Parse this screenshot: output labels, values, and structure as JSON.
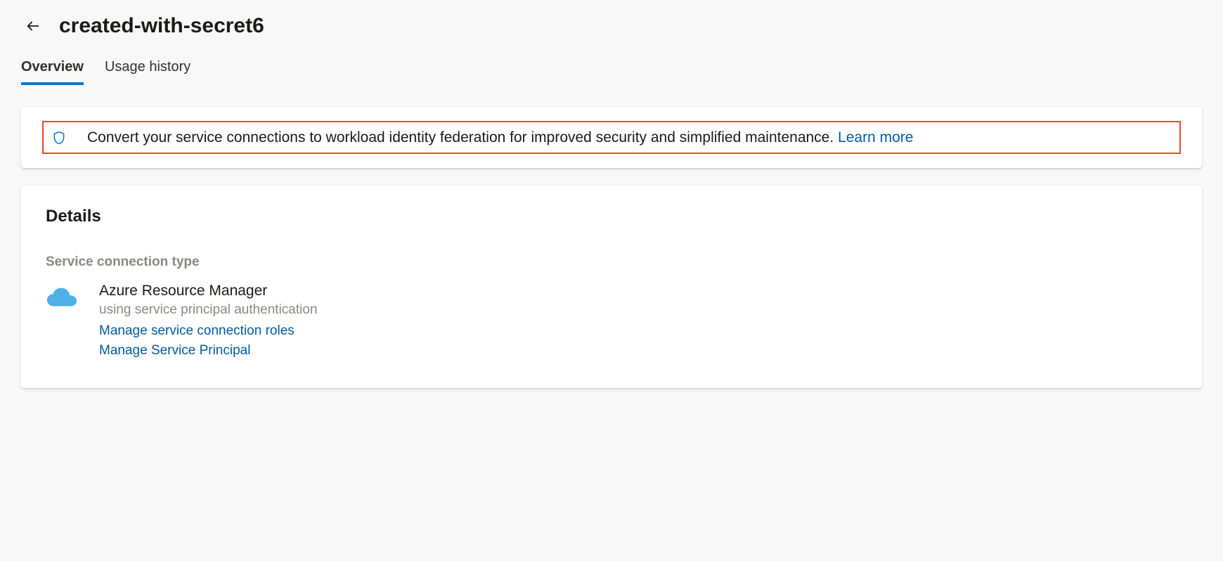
{
  "header": {
    "title": "created-with-secret6"
  },
  "tabs": {
    "overview": "Overview",
    "usage_history": "Usage history"
  },
  "banner": {
    "message": "Convert your service connections to workload identity federation for improved security and simplified maintenance. ",
    "learn_more": "Learn more"
  },
  "details": {
    "heading": "Details",
    "connection_type_label": "Service connection type",
    "connection_type_value": "Azure Resource Manager",
    "auth_method": "using service principal authentication",
    "manage_roles_link": "Manage service connection roles",
    "manage_principal_link": "Manage Service Principal"
  }
}
